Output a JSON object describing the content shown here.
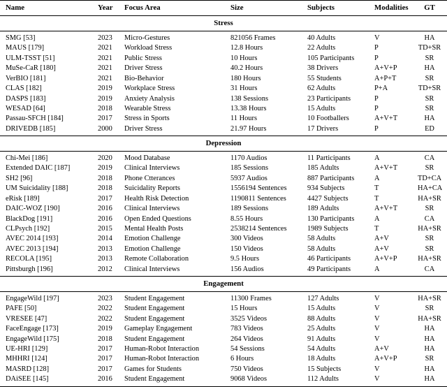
{
  "table": {
    "columns": [
      {
        "key": "name",
        "label": "Name"
      },
      {
        "key": "year",
        "label": "Year"
      },
      {
        "key": "focus",
        "label": "Focus Area"
      },
      {
        "key": "size",
        "label": "Size"
      },
      {
        "key": "subjects",
        "label": "Subjects"
      },
      {
        "key": "modalities",
        "label": "Modalities"
      },
      {
        "key": "gt",
        "label": "GT"
      }
    ],
    "sections": [
      {
        "title": "Stress",
        "rows": [
          {
            "name": "SMG [53]",
            "year": "2023",
            "focus": "Micro-Gestures",
            "size": "821056 Frames",
            "subjects": "40 Adults",
            "modalities": "V",
            "gt": "HA"
          },
          {
            "name": "MAUS [179]",
            "year": "2021",
            "focus": "Workload Stress",
            "size": "12.8 Hours",
            "subjects": "22 Adults",
            "modalities": "P",
            "gt": "TD+SR"
          },
          {
            "name": "ULM-TSST [51]",
            "year": "2021",
            "focus": "Public Stress",
            "size": "10 Hours",
            "subjects": "105 Participants",
            "modalities": "P",
            "gt": "SR"
          },
          {
            "name": "MuSe-CaR [180]",
            "year": "2021",
            "focus": "Driver Stress",
            "size": "40.2 Hours",
            "subjects": "38 Drivers",
            "modalities": "A+V+P",
            "gt": "HA"
          },
          {
            "name": "VerBIO [181]",
            "year": "2021",
            "focus": "Bio-Behavior",
            "size": "180 Hours",
            "subjects": "55 Students",
            "modalities": "A+P+T",
            "gt": "SR"
          },
          {
            "name": "CLAS [182]",
            "year": "2019",
            "focus": "Workplace Stress",
            "size": "31 Hours",
            "subjects": "62 Adults",
            "modalities": "P+A",
            "gt": "TD+SR"
          },
          {
            "name": "DASPS [183]",
            "year": "2019",
            "focus": "Anxiety Analysis",
            "size": "138 Sessions",
            "subjects": "23 Participants",
            "modalities": "P",
            "gt": "SR"
          },
          {
            "name": "WESAD [64]",
            "year": "2018",
            "focus": "Wearable Stress",
            "size": "13.38 Hours",
            "subjects": "15 Adults",
            "modalities": "P",
            "gt": "SR"
          },
          {
            "name": "Passau-SFCH [184]",
            "year": "2017",
            "focus": "Stress in Sports",
            "size": "11 Hours",
            "subjects": "10 Footballers",
            "modalities": "A+V+T",
            "gt": "HA"
          },
          {
            "name": "DRIVEDB [185]",
            "year": "2000",
            "focus": "Driver Stress",
            "size": "21.97 Hours",
            "subjects": "17 Drivers",
            "modalities": "P",
            "gt": "ED"
          }
        ]
      },
      {
        "title": "Depression",
        "rows": [
          {
            "name": "Chi-Mei [186]",
            "year": "2020",
            "focus": "Mood Database",
            "size": "1170 Audios",
            "subjects": "11 Participants",
            "modalities": "A",
            "gt": "CA"
          },
          {
            "name": "Extended DAIC [187]",
            "year": "2019",
            "focus": "Clinical Interviews",
            "size": "185 Sessions",
            "subjects": "185 Adults",
            "modalities": "A+V+T",
            "gt": "SR"
          },
          {
            "name": "SH2 [96]",
            "year": "2018",
            "focus": "Phone Ctterances",
            "size": "5937 Audios",
            "subjects": "887 Participants",
            "modalities": "A",
            "gt": "TD+CA"
          },
          {
            "name": "UM Suicidality [188]",
            "year": "2018",
            "focus": "Suicidality Reports",
            "size": "1556194 Sentences",
            "subjects": "934 Subjects",
            "modalities": "T",
            "gt": "HA+CA"
          },
          {
            "name": "eRisk [189]",
            "year": "2017",
            "focus": "Health Risk Detection",
            "size": "1190811 Sentences",
            "subjects": "4427 Subjects",
            "modalities": "T",
            "gt": "HA+SR"
          },
          {
            "name": "DAIC-WOZ [190]",
            "year": "2016",
            "focus": "Clinical Interviews",
            "size": "189 Sessions",
            "subjects": "189 Adults",
            "modalities": "A+V+T",
            "gt": "SR"
          },
          {
            "name": "BlackDog [191]",
            "year": "2016",
            "focus": "Open Ended Questions",
            "size": "8.55 Hours",
            "subjects": "130 Participants",
            "modalities": "A",
            "gt": "CA"
          },
          {
            "name": "CLPsych [192]",
            "year": "2015",
            "focus": "Mental Health Posts",
            "size": "2538214 Sentences",
            "subjects": "1989 Subjects",
            "modalities": "T",
            "gt": "HA+SR"
          },
          {
            "name": "AVEC 2014 [193]",
            "year": "2014",
            "focus": "Emotion Challenge",
            "size": "300 Videos",
            "subjects": "58 Adults",
            "modalities": "A+V",
            "gt": "SR"
          },
          {
            "name": "AVEC 2013 [194]",
            "year": "2013",
            "focus": "Emotion Challenge",
            "size": "150 Videos",
            "subjects": "58 Adults",
            "modalities": "A+V",
            "gt": "SR"
          },
          {
            "name": "RECOLA [195]",
            "year": "2013",
            "focus": "Remote Collaboration",
            "size": "9.5 Hours",
            "subjects": "46 Participants",
            "modalities": "A+V+P",
            "gt": "HA+SR"
          },
          {
            "name": "Pittsburgh [196]",
            "year": "2012",
            "focus": "Clinical Interviews",
            "size": "156 Audios",
            "subjects": "49 Participants",
            "modalities": "A",
            "gt": "CA"
          }
        ]
      },
      {
        "title": "Engagement",
        "rows": [
          {
            "name": "EngageWild [197]",
            "year": "2023",
            "focus": "Student Engagement",
            "size": "11300 Frames",
            "subjects": "127 Adults",
            "modalities": "V",
            "gt": "HA+SR"
          },
          {
            "name": "PAFE [50]",
            "year": "2022",
            "focus": "Student Engagement",
            "size": "15 Hours",
            "subjects": "15 Adults",
            "modalities": "V",
            "gt": "SR"
          },
          {
            "name": "VRESEE [47]",
            "year": "2022",
            "focus": "Student Engagement",
            "size": "3525 Videos",
            "subjects": "88 Adults",
            "modalities": "V",
            "gt": "HA+SR"
          },
          {
            "name": "FaceEngage [173]",
            "year": "2019",
            "focus": "Gameplay Engagement",
            "size": "783 Videos",
            "subjects": "25 Adults",
            "modalities": "V",
            "gt": "HA"
          },
          {
            "name": "EngageWild [175]",
            "year": "2018",
            "focus": "Student Engagement",
            "size": "264 Videos",
            "subjects": "91 Adults",
            "modalities": "V",
            "gt": "HA"
          },
          {
            "name": "UE-HRI [129]",
            "year": "2017",
            "focus": "Human-Robot Interaction",
            "size": "54 Sessions",
            "subjects": "54 Adults",
            "modalities": "A+V",
            "gt": "HA"
          },
          {
            "name": "MHHRI [124]",
            "year": "2017",
            "focus": "Human-Robot Interaction",
            "size": "6 Hours",
            "subjects": "18 Adults",
            "modalities": "A+V+P",
            "gt": "SR"
          },
          {
            "name": "MASRD [128]",
            "year": "2017",
            "focus": "Games for Students",
            "size": "750 Videos",
            "subjects": "15 Subjects",
            "modalities": "V",
            "gt": "HA"
          },
          {
            "name": "DAiSEE [145]",
            "year": "2016",
            "focus": "Student Engagement",
            "size": "9068 Videos",
            "subjects": "112 Adults",
            "modalities": "V",
            "gt": "HA"
          }
        ]
      }
    ]
  }
}
